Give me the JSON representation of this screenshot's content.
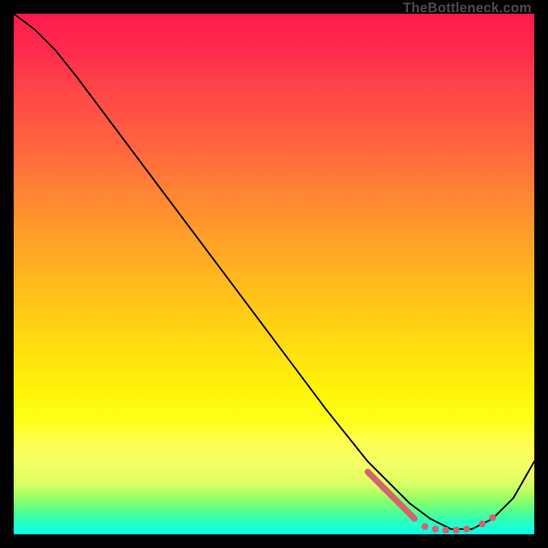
{
  "watermark": "TheBottleneck.com",
  "chart_data": {
    "type": "line",
    "title": "",
    "xlabel": "",
    "ylabel": "",
    "xlim": [
      0,
      100
    ],
    "ylim": [
      0,
      100
    ],
    "grid": false,
    "series": [
      {
        "name": "curve",
        "color": "#000000",
        "x": [
          0,
          4,
          8,
          12,
          18,
          24,
          30,
          36,
          42,
          48,
          54,
          60,
          64,
          68,
          72,
          76,
          80,
          84,
          88,
          92,
          96,
          100
        ],
        "y": [
          100,
          97,
          93,
          88,
          80,
          72,
          64,
          56,
          48,
          40,
          32,
          24,
          19,
          14,
          10,
          6,
          3,
          1,
          1,
          3,
          7,
          14
        ]
      }
    ],
    "markers": [
      {
        "name": "band-left",
        "shape": "segment",
        "color": "#d6636e",
        "x": [
          68,
          77
        ],
        "y": [
          12,
          3
        ]
      },
      {
        "name": "band-flat1",
        "shape": "dot",
        "color": "#d6636e",
        "x": 79,
        "y": 1.5
      },
      {
        "name": "band-flat2",
        "shape": "dot",
        "color": "#d6636e",
        "x": 81,
        "y": 1.0
      },
      {
        "name": "band-flat3",
        "shape": "dot",
        "color": "#d6636e",
        "x": 83,
        "y": 0.8
      },
      {
        "name": "band-flat4",
        "shape": "dot",
        "color": "#d6636e",
        "x": 85,
        "y": 0.8
      },
      {
        "name": "band-flat5",
        "shape": "dot",
        "color": "#d6636e",
        "x": 87,
        "y": 1.0
      },
      {
        "name": "band-r1",
        "shape": "dot",
        "color": "#d6636e",
        "x": 90,
        "y": 2.0
      },
      {
        "name": "band-r2",
        "shape": "dot",
        "color": "#d6636e",
        "x": 92,
        "y": 3.2
      }
    ]
  }
}
